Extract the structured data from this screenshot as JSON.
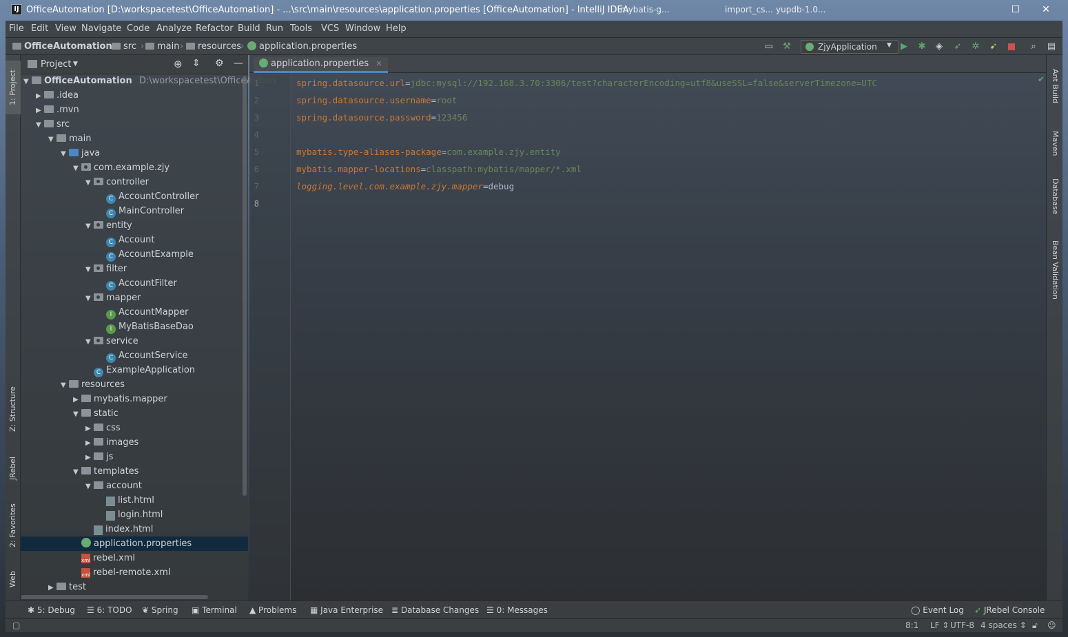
{
  "window": {
    "title": "OfficeAutomation [D:\\workspacetest\\OfficeAutomation] - ...\\src\\main\\resources\\application.properties [OfficeAutomation] - IntelliJ IDEA",
    "taskbar": [
      "mybatis-g...",
      "import_cs...",
      "yupdb-1.0..."
    ]
  },
  "menu": [
    "File",
    "Edit",
    "View",
    "Navigate",
    "Code",
    "Analyze",
    "Refactor",
    "Build",
    "Run",
    "Tools",
    "VCS",
    "Window",
    "Help"
  ],
  "breadcrumb": [
    "OfficeAutomation",
    "src",
    "main",
    "resources",
    "application.properties"
  ],
  "run_config": "ZjyApplication",
  "left_tabs": [
    "1: Project",
    "Z: Structure",
    "JRebel",
    "2: Favorites",
    "Web"
  ],
  "right_tabs": [
    "Ant Build",
    "Maven",
    "Database",
    "Bean Validation"
  ],
  "project": {
    "header": "Project",
    "root": {
      "name": "OfficeAutomation",
      "path": "D:\\workspacetest\\OfficeAutom"
    },
    "tree": [
      {
        "label": ".idea",
        "depth": 1,
        "arrow": "right",
        "icon": "folder"
      },
      {
        "label": ".mvn",
        "depth": 1,
        "arrow": "right",
        "icon": "folder"
      },
      {
        "label": "src",
        "depth": 1,
        "arrow": "down",
        "icon": "folder"
      },
      {
        "label": "main",
        "depth": 2,
        "arrow": "down",
        "icon": "folder"
      },
      {
        "label": "java",
        "depth": 3,
        "arrow": "down",
        "icon": "folder-src"
      },
      {
        "label": "com.example.zjy",
        "depth": 4,
        "arrow": "down",
        "icon": "package"
      },
      {
        "label": "controller",
        "depth": 5,
        "arrow": "down",
        "icon": "package"
      },
      {
        "label": "AccountController",
        "depth": 6,
        "arrow": "",
        "icon": "class"
      },
      {
        "label": "MainController",
        "depth": 6,
        "arrow": "",
        "icon": "class"
      },
      {
        "label": "entity",
        "depth": 5,
        "arrow": "down",
        "icon": "package"
      },
      {
        "label": "Account",
        "depth": 6,
        "arrow": "",
        "icon": "class"
      },
      {
        "label": "AccountExample",
        "depth": 6,
        "arrow": "",
        "icon": "class"
      },
      {
        "label": "filter",
        "depth": 5,
        "arrow": "down",
        "icon": "package"
      },
      {
        "label": "AccountFilter",
        "depth": 6,
        "arrow": "",
        "icon": "class"
      },
      {
        "label": "mapper",
        "depth": 5,
        "arrow": "down",
        "icon": "package"
      },
      {
        "label": "AccountMapper",
        "depth": 6,
        "arrow": "",
        "icon": "interface"
      },
      {
        "label": "MyBatisBaseDao",
        "depth": 6,
        "arrow": "",
        "icon": "interface"
      },
      {
        "label": "service",
        "depth": 5,
        "arrow": "down",
        "icon": "package"
      },
      {
        "label": "AccountService",
        "depth": 6,
        "arrow": "",
        "icon": "class"
      },
      {
        "label": "ExampleApplication",
        "depth": 5,
        "arrow": "",
        "icon": "class"
      },
      {
        "label": "resources",
        "depth": 3,
        "arrow": "down",
        "icon": "folder"
      },
      {
        "label": "mybatis.mapper",
        "depth": 4,
        "arrow": "right",
        "icon": "folder"
      },
      {
        "label": "static",
        "depth": 4,
        "arrow": "down",
        "icon": "folder"
      },
      {
        "label": "css",
        "depth": 5,
        "arrow": "right",
        "icon": "folder"
      },
      {
        "label": "images",
        "depth": 5,
        "arrow": "right",
        "icon": "folder"
      },
      {
        "label": "js",
        "depth": 5,
        "arrow": "right",
        "icon": "folder"
      },
      {
        "label": "templates",
        "depth": 4,
        "arrow": "down",
        "icon": "folder"
      },
      {
        "label": "account",
        "depth": 5,
        "arrow": "down",
        "icon": "folder"
      },
      {
        "label": "list.html",
        "depth": 6,
        "arrow": "",
        "icon": "html"
      },
      {
        "label": "login.html",
        "depth": 6,
        "arrow": "",
        "icon": "html"
      },
      {
        "label": "index.html",
        "depth": 5,
        "arrow": "",
        "icon": "html"
      },
      {
        "label": "application.properties",
        "depth": 4,
        "arrow": "",
        "icon": "properties",
        "selected": true
      },
      {
        "label": "rebel.xml",
        "depth": 4,
        "arrow": "",
        "icon": "xml"
      },
      {
        "label": "rebel-remote.xml",
        "depth": 4,
        "arrow": "",
        "icon": "xml"
      },
      {
        "label": "test",
        "depth": 2,
        "arrow": "right",
        "icon": "folder"
      }
    ]
  },
  "editor": {
    "tab": "application.properties",
    "lines": [
      {
        "n": "1",
        "key": "spring.datasource.url",
        "val": "jdbc:mysql://192.168.3.70:3306/test?characterEncoding=utf8&useSSL=false&serverTimezone=UTC"
      },
      {
        "n": "2",
        "key": "spring.datasource.username",
        "val": "root"
      },
      {
        "n": "3",
        "key": "spring.datasource.password",
        "val": "123456"
      },
      {
        "n": "4",
        "key": "",
        "val": ""
      },
      {
        "n": "5",
        "key": "mybatis.type-aliases-package",
        "val": "com.example.zjy.entity"
      },
      {
        "n": "6",
        "key": "mybatis.mapper-locations",
        "val": "classpath:mybatis/mapper/*.xml"
      },
      {
        "n": "7",
        "key": "logging.level.com.example.zjy.mapper",
        "val": "debug",
        "italic": true
      },
      {
        "n": "8",
        "key": "",
        "val": ""
      }
    ]
  },
  "bottom_tools": [
    "5: Debug",
    "6: TODO",
    "Spring",
    "Terminal",
    "Problems",
    "Java Enterprise",
    "Database Changes",
    "0: Messages"
  ],
  "bottom_right": [
    "Event Log",
    "JRebel Console"
  ],
  "status": {
    "position": "8:1",
    "line_sep": "LF",
    "encoding": "UTF-8",
    "indent": "4 spaces"
  },
  "colors": {
    "key": "#cc7832",
    "value": "#6a8759",
    "selection": "#0d293e",
    "accent": "#4a88c7"
  }
}
